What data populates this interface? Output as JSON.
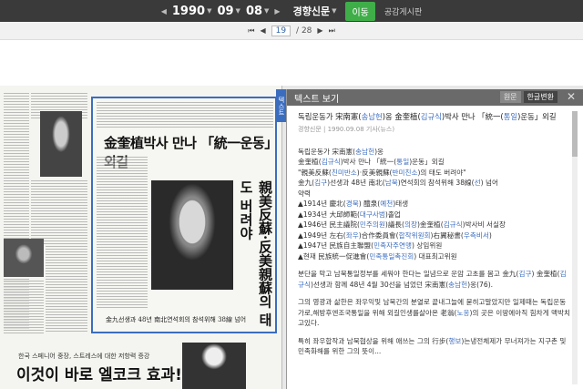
{
  "topbar": {
    "year": "1990",
    "month": "09",
    "day": "08",
    "newspaper": "경향신문",
    "go_label": "이동",
    "board_label": "공감게시판"
  },
  "pager": {
    "current": "19",
    "total": "/ 28"
  },
  "newspaper_page": {
    "headline": "金奎植박사 만나 「統一운동」외길",
    "vertical_headline": "親美反蘇·反美親蘇의 태도 버려야",
    "caption": "金九선생과 48년 南北연석회의 참석위해 38線 넘어",
    "ad_subtitle": "한국 스페니어 중장, 스트레스에 대한 저항력 증강",
    "ad_headline": "이것이 바로 엘코크 효과!"
  },
  "panel": {
    "header": "텍스트 보기",
    "tab_original": "원문",
    "tab_hangul": "한글변환",
    "close": "✕",
    "side_tab": "텍스트"
  },
  "article": {
    "title_a": "독립운동가 宋南憲(",
    "title_h1": "송남헌",
    "title_b": ")옹 金奎植(",
    "title_h2": "김규식",
    "title_c": ")박사 만나 「統一(",
    "title_h3": "통일",
    "title_d": ")운동」외길",
    "meta": "경향신문 | 1990.09.08 기사(뉴스)",
    "line1a": "독립운동가 宋南憲(",
    "line1h": "송남헌",
    "line1b": ")옹",
    "line2a": "金奎植(",
    "line2h": "김규식",
    "line2b": ")박사 만나 「統一(",
    "line2h2": "통일",
    "line2c": ")운동」외길",
    "line3a": "\"親美反蘇(",
    "line3h": "친미반소",
    "line3b": ")·反美親蘇(",
    "line3h2": "반미친소",
    "line3c": ")의 태도 버려야\"",
    "line4a": "金九(",
    "line4h": "김구",
    "line4b": ")선생과 48년 南北(",
    "line4h2": "남북",
    "line4c": ")연석회의 참석위해 38線(",
    "line4h3": "선",
    "line4d": ") 넘어",
    "line5": "약력",
    "line6a": "▲1914년 慶北(",
    "line6h": "경북",
    "line6b": ") 醴泉(",
    "line6h2": "예천",
    "line6c": ")태생",
    "line7a": "▲1934년 大邱師範(",
    "line7h": "대구사범",
    "line7b": ")졸업",
    "line8a": "▲1946년 民主議院(",
    "line8h": "민주의원",
    "line8b": ")議長(",
    "line8h2": "의장",
    "line8c": ")金奎植(",
    "line8h3": "김규식",
    "line8d": ")박사비 서실장",
    "line9a": "▲1949년 左右(",
    "line9h": "좌우",
    "line9b": ")合作委員會(",
    "line9h2": "합작위원회",
    "line9c": ")右翼秘書(",
    "line9h3": "우측비서",
    "line9d": ")",
    "line10a": "▲1947년 民族自主聯盟(",
    "line10h": "민족자주연맹",
    "line10b": ") 상임위원",
    "line11a": "▲현재 民族統一促進會(",
    "line11h": "민족통일촉진회",
    "line11b": ") 대표최고위원",
    "para1a": "분단을 막고 남북통일정부를 세워야 한다는 일념으로 운암 고초를 몸고 金九(",
    "para1h": "김구",
    "para1b": ") 金奎植(",
    "para1h2": "김규식",
    "para1c": ")선생과 함께 48년 4월 30선을 넘었던 宋南憲(",
    "para1h3": "송남헌",
    "para1d": ")옹(76).",
    "para2a": "그의 영광과 삶한은 좌우익및 남북간의 분열로 끝내그늘에 묻히고말았지만 일제때는 독립운동가로,해방후엔조국통일을 위해 외길인생를살아온 老翁(",
    "para2h": "노옹",
    "para2b": ")의 곳은 이땅에아직 힘차게 맥박치고있다.",
    "para3a": "특히 좌우합작과 남북협상을 위해 애쓰는 그의 行步(",
    "para3h": "행보",
    "para3b": ")는냉전체제가 무너져가는 지구촌 및 민족화해를 위한 그의 뜻이..."
  }
}
